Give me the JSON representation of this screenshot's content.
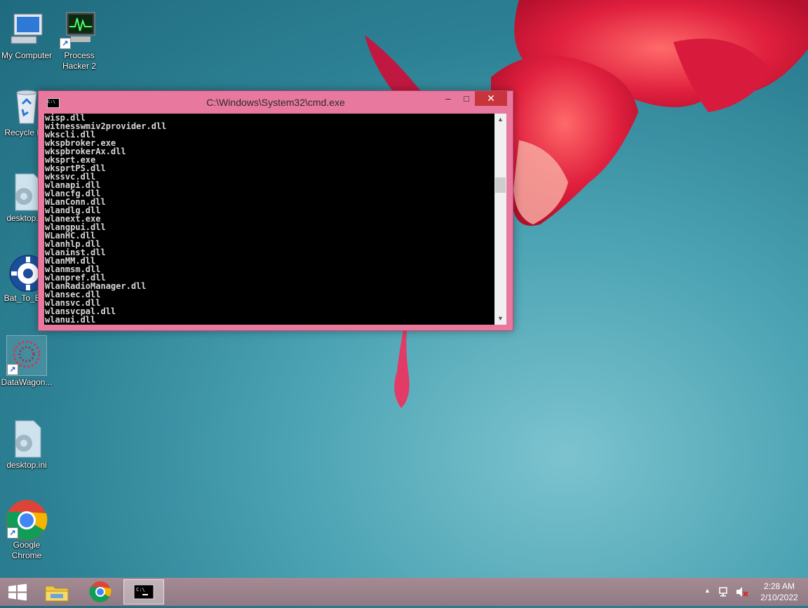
{
  "desktop": {
    "icons": [
      {
        "label": "My Computer"
      },
      {
        "label": "Process Hacker 2"
      },
      {
        "label": "Recycle Bin"
      },
      {
        "label": "desktop.ini"
      },
      {
        "label": "Bat_To_Exe"
      },
      {
        "label": "DataWagon..."
      },
      {
        "label": "desktop.ini"
      },
      {
        "label": "Google Chrome"
      }
    ]
  },
  "window": {
    "title": "C:\\Windows\\System32\\cmd.exe",
    "minimize_label": "–",
    "maximize_label": "□",
    "close_label": "✕",
    "lines": [
      "wisp.dll",
      "witnesswmiv2provider.dll",
      "wkscli.dll",
      "wkspbroker.exe",
      "wkspbrokerAx.dll",
      "wksprt.exe",
      "wksprtPS.dll",
      "wkssvc.dll",
      "wlanapi.dll",
      "wlancfg.dll",
      "WLanConn.dll",
      "wlandlg.dll",
      "wlanext.exe",
      "wlangpui.dll",
      "WLanHC.dll",
      "wlanhlp.dll",
      "wlaninst.dll",
      "WlanMM.dll",
      "wlanmsm.dll",
      "wlanpref.dll",
      "WlanRadioManager.dll",
      "wlansec.dll",
      "wlansvc.dll",
      "wlansvcpal.dll",
      "wlanui.dll"
    ],
    "scroll_position": 0.3
  },
  "taskbar": {
    "clock_time": "2:28 AM",
    "clock_date": "2/10/2022"
  }
}
